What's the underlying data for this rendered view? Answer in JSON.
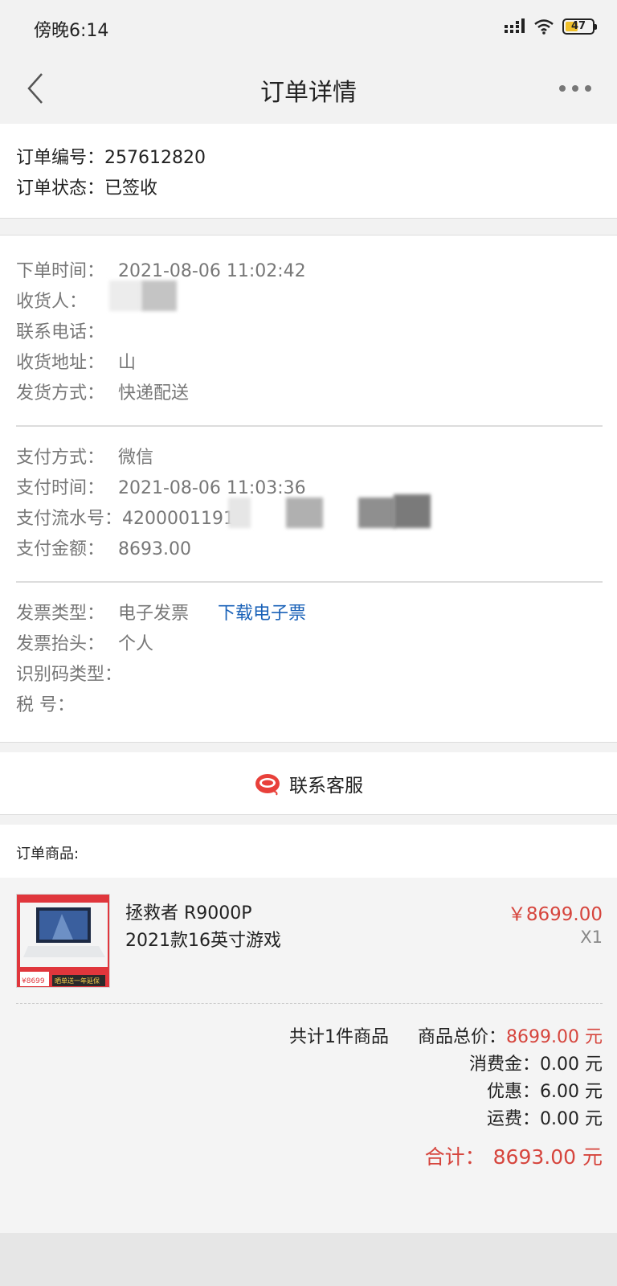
{
  "status_bar": {
    "time": "傍晚6:14",
    "battery": "47",
    "battery_level": 0.47
  },
  "nav": {
    "title": "订单详情"
  },
  "order": {
    "number_label": "订单编号：",
    "number": "257612820",
    "status_label": "订单状态：",
    "status": "已签收"
  },
  "shipping": {
    "order_time_label": "下单时间：",
    "order_time": "2021-08-06 11:02:42",
    "receiver_label": "收货人：",
    "phone_label": "联系电话：",
    "address_label": "收货地址：",
    "address_partial": "山",
    "delivery_label": "发货方式：",
    "delivery": "快递配送"
  },
  "payment": {
    "method_label": "支付方式：",
    "method": "微信",
    "time_label": "支付时间：",
    "time": "2021-08-06 11:03:36",
    "serial_label": "支付流水号：",
    "serial_partial": "42000011912",
    "amount_label": "支付金额：",
    "amount": "8693.00"
  },
  "invoice": {
    "type_label": "发票类型：",
    "type": "电子发票",
    "download_label": "下载电子票",
    "title_label": "发票抬头：",
    "title": "个人",
    "id_type_label": "识别码类型：",
    "tax_label": "税 号："
  },
  "service": {
    "label": "联系客服"
  },
  "goods": {
    "section_title": "订单商品:",
    "name_line1": "拯救者 R9000P",
    "name_line2": "2021款16英寸游戏",
    "price": "￥8699.00",
    "qty": "X1",
    "thumb_price": "¥8699",
    "thumb_banner": "晒单送一年延保"
  },
  "summary": {
    "count": "共计1件商品",
    "subtotal_label": "商品总价：",
    "subtotal": "8699.00 元",
    "consume_label": "消费金：",
    "consume": "0.00 元",
    "discount_label": "优惠：",
    "discount": "6.00 元",
    "shipping_label": "运费：",
    "shipping": "0.00 元",
    "total_label": "合计：",
    "total": "8693.00 元"
  },
  "colors": {
    "accent_red": "#d6453d",
    "link_blue": "#1a62b8"
  }
}
